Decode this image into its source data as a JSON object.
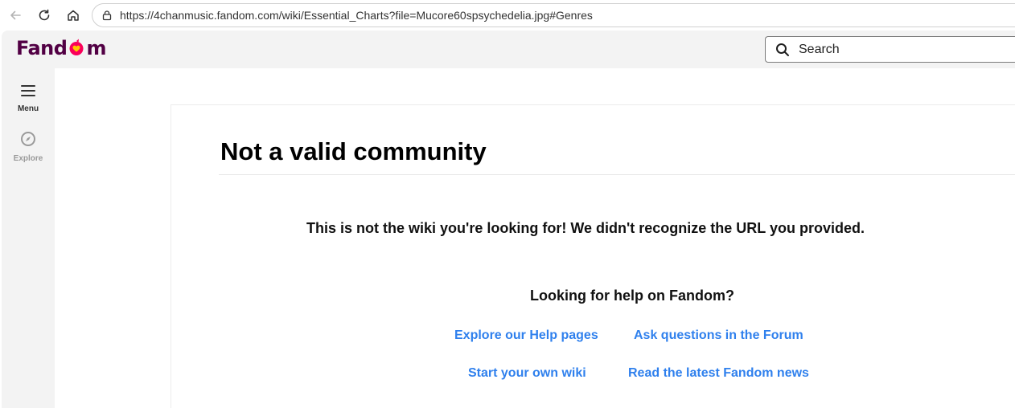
{
  "browser": {
    "url": "https://4chanmusic.fandom.com/wiki/Essential_Charts?file=Mucore60spsychedelia.jpg#Genres",
    "icons": [
      "back-icon",
      "reload-icon",
      "home-icon",
      "lock-icon"
    ]
  },
  "header": {
    "logo_left": "Fand",
    "logo_right": "m",
    "search_label": "Search",
    "brand_color": "#520044",
    "accent_color": "#fa005a"
  },
  "siderail": {
    "menu_label": "Menu",
    "explore_label": "Explore"
  },
  "main": {
    "title": "Not a valid community",
    "message": "This is not the wiki you're looking for! We didn't recognize the URL you provided.",
    "help_heading": "Looking for help on Fandom?",
    "links": [
      "Explore our Help pages",
      "Ask questions in the Forum",
      "Start your own wiki",
      "Read the latest Fandom news"
    ],
    "link_color": "#2f80ed"
  }
}
